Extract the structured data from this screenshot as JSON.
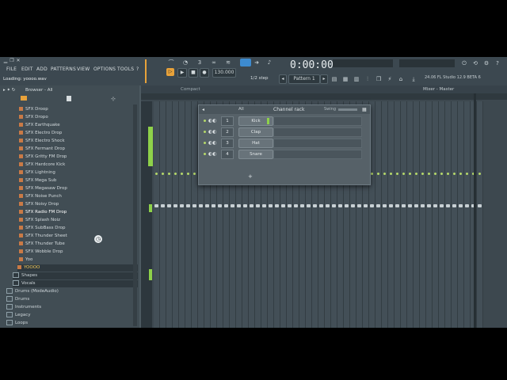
{
  "menu": [
    "FILE",
    "EDIT",
    "ADD",
    "PATTERNS",
    "VIEW",
    "OPTIONS",
    "TOOLS",
    "?"
  ],
  "hint": "Loading: yoooo.wav",
  "transport": {
    "tempo": "130.000",
    "time": "0:00:00",
    "step": "1/2 step",
    "pattern": "Pattern 1"
  },
  "app_version": "24.06 FL Studio 12.9 BETA 6",
  "browser": {
    "title": "Browser - All",
    "items": [
      "SFX Droop",
      "SFX Dropo",
      "SFX Earthquake",
      "SFX Electro Drop",
      "SFX Electro Shock",
      "SFX Fermant Drop",
      "SFX Gritty FM Drop",
      "SFX Hardcore Kick",
      "SFX Lightning",
      "SFX Mega Sub",
      "SFX Megasaw Drop",
      "SFX Noise Punch",
      "SFX Noisy Drop",
      "SFX Radio FM Drop",
      "SFX Splash Noiz",
      "SFX SubBass Drop",
      "SFX Thunder Sheet",
      "SFX Thunder Tube",
      "SFX Wobble Drop",
      "Yoo"
    ],
    "selected_item": "YOOOO",
    "folders": [
      "Shapes",
      "Vocals",
      "Drums (ModeAudio)",
      "Drums",
      "Instruments",
      "Legacy",
      "Loops"
    ]
  },
  "mixer": {
    "view_label": "Compact",
    "title": "Mixer - Master"
  },
  "channel_rack": {
    "filter": "All",
    "title": "Channel rack",
    "swing": "Swing",
    "channels": [
      {
        "num": "1",
        "name": "Kick"
      },
      {
        "num": "2",
        "name": "Clap"
      },
      {
        "num": "3",
        "name": "Hat"
      },
      {
        "num": "4",
        "name": "Snare"
      }
    ],
    "add_label": "+"
  },
  "colors": {
    "accent_orange": "#e8a23a",
    "meter_green": "#8ed14a",
    "led_green": "#b5d86a"
  }
}
